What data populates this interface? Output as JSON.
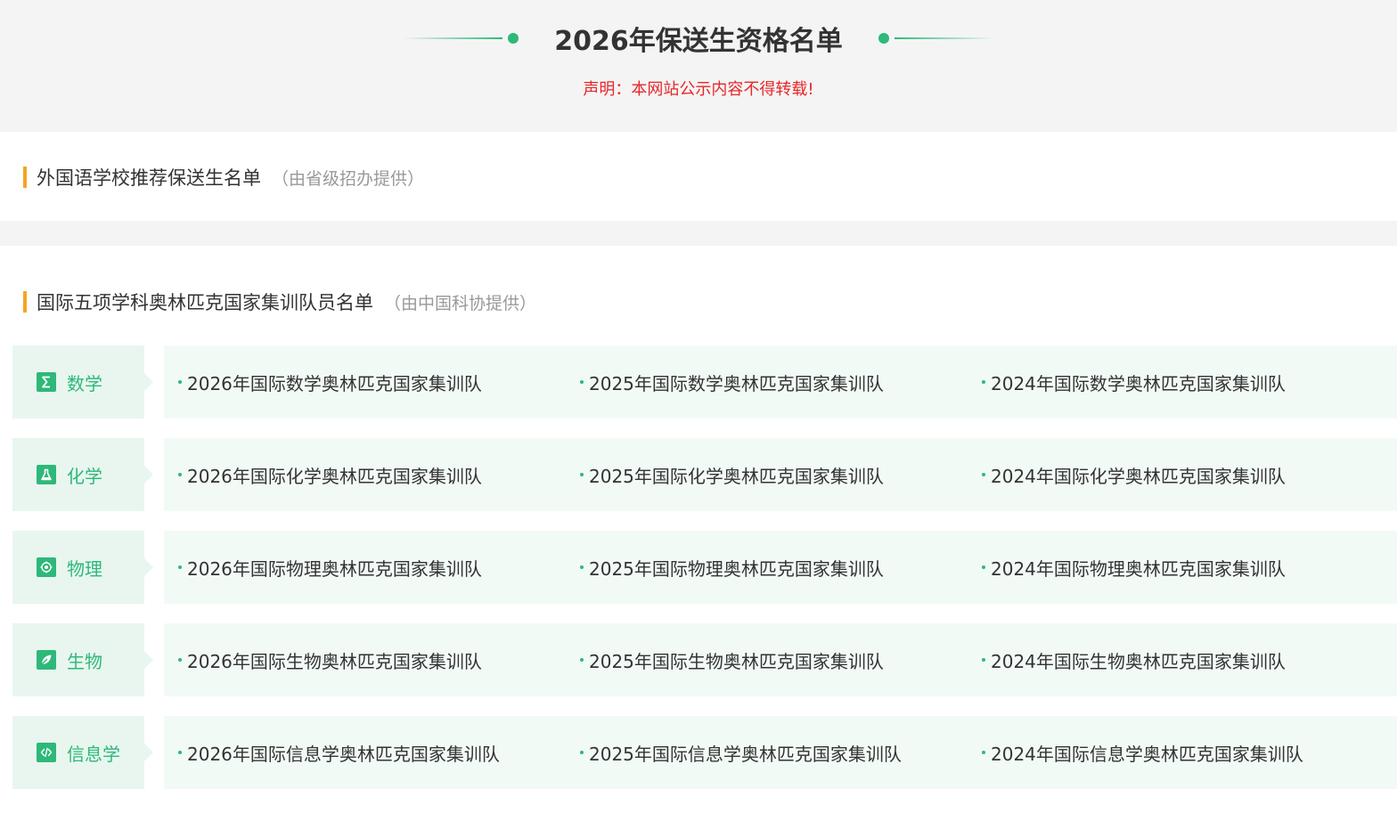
{
  "header": {
    "title": "2026年保送生资格名单",
    "notice": "声明：本网站公示内容不得转载!"
  },
  "section_foreign": {
    "title": "外国语学校推荐保送生名单",
    "source": "（由省级招办提供）"
  },
  "section_olympiad": {
    "title": "国际五项学科奥林匹克国家集训队员名单",
    "source": "（由中国科协提供）"
  },
  "subjects": [
    {
      "name": "数学",
      "icon": "sigma-icon",
      "links": [
        "2026年国际数学奥林匹克国家集训队",
        "2025年国际数学奥林匹克国家集训队",
        "2024年国际数学奥林匹克国家集训队"
      ]
    },
    {
      "name": "化学",
      "icon": "flask-icon",
      "links": [
        "2026年国际化学奥林匹克国家集训队",
        "2025年国际化学奥林匹克国家集训队",
        "2024年国际化学奥林匹克国家集训队"
      ]
    },
    {
      "name": "物理",
      "icon": "atom-icon",
      "links": [
        "2026年国际物理奥林匹克国家集训队",
        "2025年国际物理奥林匹克国家集训队",
        "2024年国际物理奥林匹克国家集训队"
      ]
    },
    {
      "name": "生物",
      "icon": "leaf-icon",
      "links": [
        "2026年国际生物奥林匹克国家集训队",
        "2025年国际生物奥林匹克国家集训队",
        "2024年国际生物奥林匹克国家集训队"
      ]
    },
    {
      "name": "信息学",
      "icon": "code-icon",
      "links": [
        "2026年国际信息学奥林匹克国家集训队",
        "2025年国际信息学奥林匹克国家集训队",
        "2024年国际信息学奥林匹克国家集训队"
      ]
    }
  ],
  "colors": {
    "accent": "#2eb87a",
    "notice_red": "#e8262a",
    "section_bar": "#f5a623"
  }
}
